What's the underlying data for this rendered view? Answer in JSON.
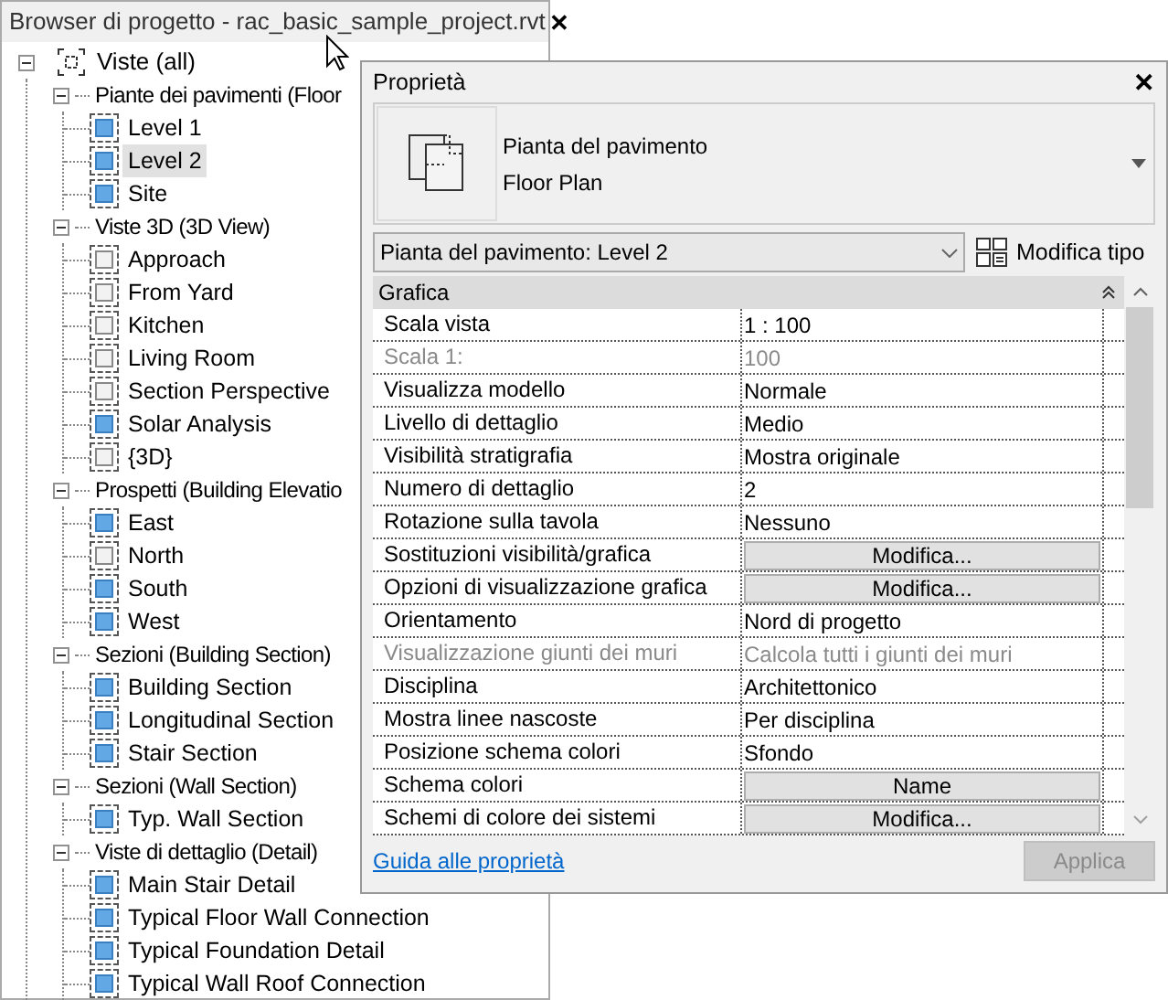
{
  "browser": {
    "title": "Browser di progetto - rac_basic_sample_project.rvt",
    "close": "✕",
    "root": {
      "label": "Viste (all)",
      "expanded": true,
      "children": [
        {
          "label": "Piante dei pavimenti (Floor",
          "expanded": true,
          "children": [
            {
              "label": "Level 1",
              "placed": true,
              "selected": false
            },
            {
              "label": "Level 2",
              "placed": true,
              "selected": true
            },
            {
              "label": "Site",
              "placed": true,
              "selected": false
            }
          ]
        },
        {
          "label": "Viste 3D (3D View)",
          "expanded": true,
          "children": [
            {
              "label": "Approach",
              "placed": false,
              "selected": false
            },
            {
              "label": "From Yard",
              "placed": false,
              "selected": false
            },
            {
              "label": "Kitchen",
              "placed": false,
              "selected": false
            },
            {
              "label": "Living Room",
              "placed": false,
              "selected": false
            },
            {
              "label": "Section Perspective",
              "placed": false,
              "selected": false
            },
            {
              "label": "Solar Analysis",
              "placed": true,
              "selected": false
            },
            {
              "label": "{3D}",
              "placed": false,
              "selected": false
            }
          ]
        },
        {
          "label": "Prospetti (Building Elevatio",
          "expanded": true,
          "children": [
            {
              "label": "East",
              "placed": true,
              "selected": false
            },
            {
              "label": "North",
              "placed": false,
              "selected": false
            },
            {
              "label": "South",
              "placed": true,
              "selected": false
            },
            {
              "label": "West",
              "placed": true,
              "selected": false
            }
          ]
        },
        {
          "label": "Sezioni (Building Section)",
          "expanded": true,
          "children": [
            {
              "label": "Building Section",
              "placed": true,
              "selected": false
            },
            {
              "label": "Longitudinal Section",
              "placed": true,
              "selected": false
            },
            {
              "label": "Stair Section",
              "placed": true,
              "selected": false
            }
          ]
        },
        {
          "label": "Sezioni (Wall Section)",
          "expanded": true,
          "children": [
            {
              "label": "Typ. Wall Section",
              "placed": true,
              "selected": false
            }
          ]
        },
        {
          "label": "Viste di dettaglio (Detail)",
          "expanded": true,
          "children": [
            {
              "label": "Main Stair Detail",
              "placed": true,
              "selected": false
            },
            {
              "label": "Typical Floor Wall Connection",
              "placed": true,
              "selected": false
            },
            {
              "label": "Typical Foundation Detail",
              "placed": true,
              "selected": false
            },
            {
              "label": "Typical Wall Roof Connection",
              "placed": true,
              "selected": false
            }
          ]
        }
      ]
    }
  },
  "properties": {
    "title": "Proprietà",
    "close": "✕",
    "type": {
      "family": "Pianta del pavimento",
      "type_name": "Floor Plan"
    },
    "instance_dropdown": "Pianta del pavimento: Level 2",
    "edit_type_button": "Modifica tipo",
    "group": {
      "label": "Grafica",
      "expanded": true
    },
    "rows": [
      {
        "label": "Scala vista",
        "value": "1 : 100",
        "kind": "text",
        "disabled": false
      },
      {
        "label": "Scala  1:",
        "value": "100",
        "kind": "text",
        "disabled": true
      },
      {
        "label": "Visualizza modello",
        "value": "Normale",
        "kind": "text",
        "disabled": false
      },
      {
        "label": "Livello di dettaglio",
        "value": "Medio",
        "kind": "text",
        "disabled": false
      },
      {
        "label": "Visibilità stratigrafia",
        "value": "Mostra originale",
        "kind": "text",
        "disabled": false
      },
      {
        "label": "Numero di dettaglio",
        "value": "2",
        "kind": "text",
        "disabled": false
      },
      {
        "label": "Rotazione sulla tavola",
        "value": "Nessuno",
        "kind": "text",
        "disabled": false
      },
      {
        "label": "Sostituzioni visibilità/grafica",
        "value": "Modifica...",
        "kind": "button",
        "disabled": false
      },
      {
        "label": "Opzioni di visualizzazione grafica",
        "value": "Modifica...",
        "kind": "button",
        "disabled": false
      },
      {
        "label": "Orientamento",
        "value": "Nord di progetto",
        "kind": "text",
        "disabled": false
      },
      {
        "label": "Visualizzazione giunti dei muri",
        "value": "Calcola tutti i giunti dei muri",
        "kind": "text",
        "disabled": true
      },
      {
        "label": "Disciplina",
        "value": "Architettonico",
        "kind": "text",
        "disabled": false
      },
      {
        "label": "Mostra linee nascoste",
        "value": "Per disciplina",
        "kind": "text",
        "disabled": false
      },
      {
        "label": "Posizione schema colori",
        "value": "Sfondo",
        "kind": "text",
        "disabled": false
      },
      {
        "label": "Schema colori",
        "value": "Name",
        "kind": "button",
        "disabled": false
      },
      {
        "label": "Schemi di colore dei sistemi",
        "value": "Modifica...",
        "kind": "button",
        "disabled": false
      }
    ],
    "help_link": "Guida alle proprietà",
    "apply_button": {
      "label": "Applica",
      "disabled": true
    }
  }
}
